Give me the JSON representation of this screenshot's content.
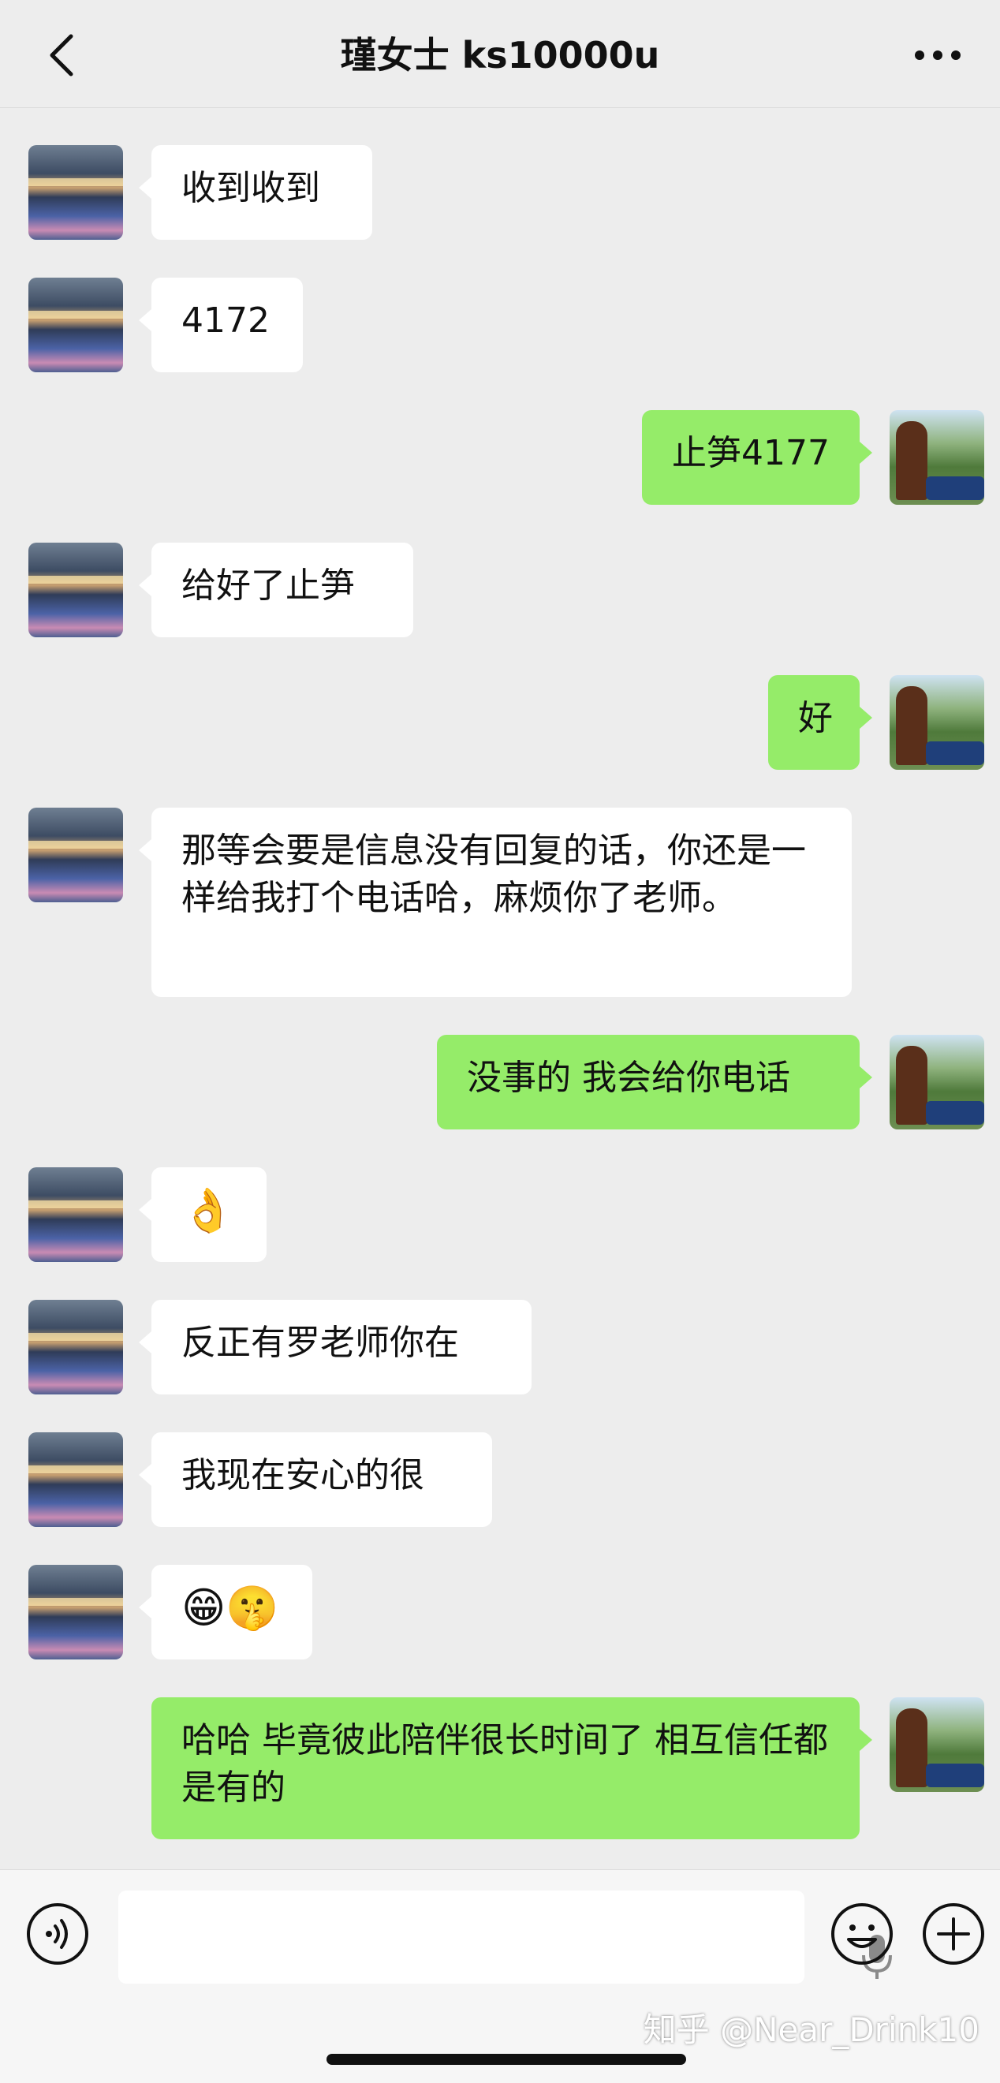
{
  "header": {
    "title": "瑾女士 ks10000u"
  },
  "messages": [
    {
      "side": "left",
      "text": "收到收到"
    },
    {
      "side": "left",
      "text": "4172"
    },
    {
      "side": "right",
      "text": "止笋4177"
    },
    {
      "side": "left",
      "text": "给好了止笋"
    },
    {
      "side": "right",
      "text": "好"
    },
    {
      "side": "left",
      "text": "那等会要是信息没有回复的话，你还是一样给我打个电话哈，麻烦你了老师。"
    },
    {
      "side": "right",
      "text": "没事的 我会给你电话"
    },
    {
      "side": "left",
      "text": "👌"
    },
    {
      "side": "left",
      "text": "反正有罗老师你在"
    },
    {
      "side": "left",
      "text": "我现在安心的很"
    },
    {
      "side": "left",
      "text": "😁🤫"
    },
    {
      "side": "right",
      "text": "哈哈 毕竟彼此陪伴很长时间了 相互信任都是有的"
    }
  ],
  "input": {
    "placeholder": ""
  },
  "watermark": "知乎 @Near_Drink10",
  "colors": {
    "background": "#ededed",
    "incoming_bubble": "#ffffff",
    "outgoing_bubble": "#95ec69"
  },
  "icons": [
    "back-icon",
    "more-icon",
    "voice-icon",
    "mic-icon",
    "emoji-icon",
    "plus-icon"
  ]
}
